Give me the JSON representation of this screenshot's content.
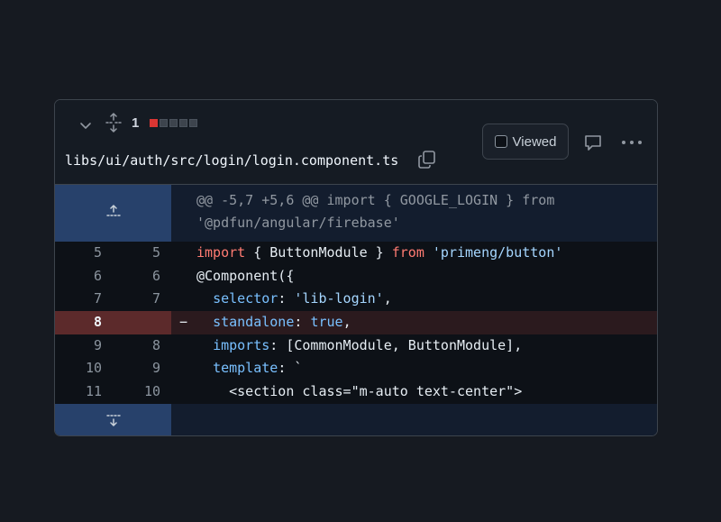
{
  "file_header": {
    "collapse_icon": "chevron-down-icon",
    "expand_icon": "unfold-icon",
    "changes_count": "1",
    "diffstat": [
      "deleted",
      "neutral",
      "neutral",
      "neutral",
      "neutral"
    ],
    "file_path": "libs/ui/auth/src/login/login.component.ts",
    "copy_icon": "copy-icon",
    "viewed_label": "Viewed",
    "viewed_checked": false,
    "comment_icon": "comment-icon",
    "more_icon": "kebab-horizontal-icon"
  },
  "colors": {
    "deleted_gutter": "#5c2a2b",
    "deleted_row": "#2b1a1e",
    "hunk_gutter": "#27416b",
    "keyword": "#ff7b72",
    "string": "#a5d6ff",
    "property": "#79c0ff"
  },
  "hunk": {
    "line1": "@@ -5,7 +5,6 @@ import { GOOGLE_LOGIN } from",
    "line2": "'@pdfun/angular/firebase'"
  },
  "lines": [
    {
      "old": "5",
      "new": "5",
      "marker": "",
      "type": "context",
      "tokens": [
        [
          "kw",
          "import"
        ],
        [
          "plain",
          " { ButtonModule } "
        ],
        [
          "kw",
          "from"
        ],
        [
          "plain",
          " "
        ],
        [
          "str",
          "'primeng/button'"
        ]
      ]
    },
    {
      "old": "6",
      "new": "6",
      "marker": "",
      "type": "context",
      "tokens": [
        [
          "plain",
          "@Component({"
        ]
      ]
    },
    {
      "old": "7",
      "new": "7",
      "marker": "",
      "type": "context",
      "tokens": [
        [
          "plain",
          "  "
        ],
        [
          "prop",
          "selector"
        ],
        [
          "plain",
          ": "
        ],
        [
          "str",
          "'lib-login'"
        ],
        [
          "plain",
          ","
        ]
      ]
    },
    {
      "old": "8",
      "new": "",
      "marker": "−",
      "type": "deleted",
      "tokens": [
        [
          "plain",
          "  "
        ],
        [
          "prop",
          "standalone"
        ],
        [
          "plain",
          ": "
        ],
        [
          "prop",
          "true"
        ],
        [
          "plain",
          ","
        ]
      ]
    },
    {
      "old": "9",
      "new": "8",
      "marker": "",
      "type": "context",
      "tokens": [
        [
          "plain",
          "  "
        ],
        [
          "prop",
          "imports"
        ],
        [
          "plain",
          ": [CommonModule, ButtonModule],"
        ]
      ]
    },
    {
      "old": "10",
      "new": "9",
      "marker": "",
      "type": "context",
      "tokens": [
        [
          "plain",
          "  "
        ],
        [
          "prop",
          "template"
        ],
        [
          "plain",
          ": `"
        ]
      ]
    },
    {
      "old": "11",
      "new": "10",
      "marker": "",
      "type": "context",
      "tokens": [
        [
          "plain",
          "    <section class=\"m-auto text-center\">"
        ]
      ]
    }
  ]
}
